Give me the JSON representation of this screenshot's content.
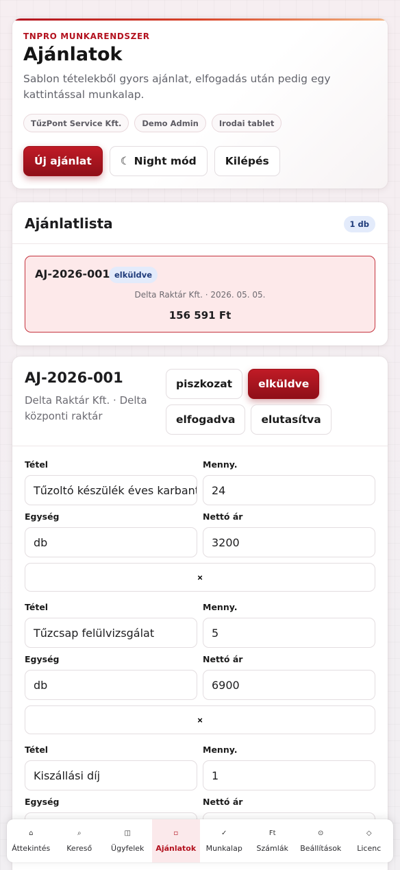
{
  "header": {
    "eyebrow": "TNPRO MUNKARENDSZER",
    "title": "Ajánlatok",
    "subtitle": "Sablon tételekből gyors ajánlat, elfogadás után pedig egy kattintással munkalap.",
    "chips": [
      "TűzPont Service Kft.",
      "Demo Admin",
      "Irodai tablet"
    ],
    "new_offer_label": "Új ajánlat",
    "night_mode_icon": "☾",
    "night_mode_label": "Night mód",
    "logout_label": "Kilépés"
  },
  "offer_list": {
    "title": "Ajánlatlista",
    "count": "1 db",
    "items": [
      {
        "code": "AJ-2026-001",
        "status": "elküldve",
        "meta": "Delta Raktár Kft. · 2026. 05. 05.",
        "total": "156 591 Ft"
      }
    ]
  },
  "detail": {
    "code": "AJ-2026-001",
    "subtitle": "Delta Raktár Kft. · Delta központi raktár",
    "statuses": [
      "piszkozat",
      "elküldve",
      "elfogadva",
      "elutasítva"
    ],
    "active_status": "elküldve",
    "labels": {
      "item": "Tétel",
      "qty": "Menny.",
      "unit": "Egység",
      "net_price": "Nettó ár"
    },
    "remove_label": "×",
    "line_items": [
      {
        "item": "Tűzoltó készülék éves karbantartás",
        "qty": "24",
        "unit": "db",
        "net_price": "3200"
      },
      {
        "item": "Tűzcsap felülvizsgálat",
        "qty": "5",
        "unit": "db",
        "net_price": "6900"
      },
      {
        "item": "Kiszállási díj",
        "qty": "1",
        "unit": "",
        "net_price": ""
      }
    ]
  },
  "bottom_nav": {
    "items": [
      {
        "label": "Áttekintés",
        "icon": "⌂"
      },
      {
        "label": "Kereső",
        "icon": "⌕"
      },
      {
        "label": "Ügyfelek",
        "icon": "◫"
      },
      {
        "label": "Ajánlatok",
        "icon": "▫"
      },
      {
        "label": "Munkalap",
        "icon": "✓"
      },
      {
        "label": "Számlák",
        "icon": "Ft"
      },
      {
        "label": "Beállítások",
        "icon": "⊙"
      },
      {
        "label": "Licenc",
        "icon": "◇"
      }
    ],
    "active": "Ajánlatok"
  },
  "colors": {
    "brand_red": "#b3121f",
    "badge_blue_bg": "#e3ebfb",
    "badge_blue_text": "#1f3b7a"
  }
}
